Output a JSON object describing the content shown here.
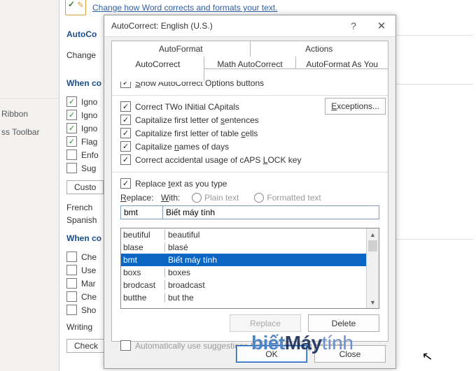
{
  "bg": {
    "link": "Change how Word corrects and formats your text.",
    "section1": "AutoCo",
    "section1_sub": "Change",
    "section2": "When co",
    "opts2": [
      "Igno",
      "Igno",
      "Igno",
      "Flag",
      "Enfo",
      "Sug"
    ],
    "opts2_chk": [
      true,
      true,
      true,
      true,
      false,
      false
    ],
    "custom_btn": "Custo",
    "french": "French",
    "spanish": "Spanish",
    "section3": "When co",
    "opts3": [
      "Che",
      "Use",
      "Mar",
      "Che",
      "Sho"
    ],
    "opts3_chk": [
      false,
      false,
      false,
      false,
      false
    ],
    "writing": "Writing",
    "check_btn": "Check",
    "nav": [
      "Ribbon",
      "ss Toolbar",
      ""
    ]
  },
  "dlg": {
    "title": "AutoCorrect: English (U.S.)",
    "help": "?",
    "close": "✕",
    "tabs_r1": [
      "AutoFormat",
      "Actions"
    ],
    "tabs_r2": [
      "AutoCorrect",
      "Math AutoCorrect",
      "AutoFormat As You Type"
    ],
    "show_opt": "Show AutoCorrect Options buttons",
    "opts": [
      "Correct TWo INitial CApitals",
      "Capitalize first letter of sentences",
      "Capitalize first letter of table cells",
      "Capitalize names of days",
      "Correct accidental usage of cAPS LOCK key"
    ],
    "exceptions": "Exceptions...",
    "replace_as": "Replace text as you type",
    "replace_lbl": "Replace:",
    "with_lbl": "With:",
    "plain": "Plain text",
    "formatted": "Formatted text",
    "replace_val": "bmt",
    "with_val": "Biết máy tính",
    "list": [
      {
        "a": "beutiful",
        "b": "beautiful"
      },
      {
        "a": "blase",
        "b": "blasé"
      },
      {
        "a": "bmt",
        "b": "Biết máy tính"
      },
      {
        "a": "boxs",
        "b": "boxes"
      },
      {
        "a": "brodcast",
        "b": "broadcast"
      },
      {
        "a": "butthe",
        "b": "but the"
      }
    ],
    "selected_index": 2,
    "replace_btn": "Replace",
    "delete_btn": "Delete",
    "autospell": "Automatically use suggestions from the spelling checker",
    "ok": "OK",
    "close_btn": "Close"
  },
  "watermark": {
    "a": "biết",
    "b": "Máy",
    "c": "tính"
  }
}
